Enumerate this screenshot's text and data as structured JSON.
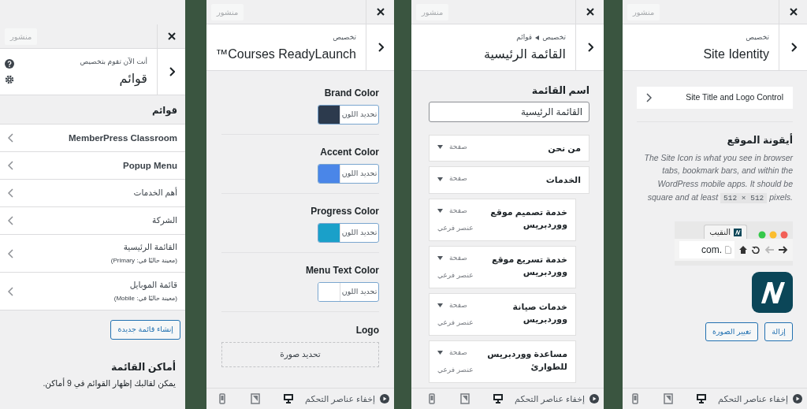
{
  "menus_panel": {
    "publish_button": {
      "label": "منشور",
      "disabled": true
    },
    "subtitle": "أنت الآن تقوم بتخصيص",
    "title": "قوائم",
    "section_title": "قوائم",
    "menus": [
      {
        "label": "MemberPress Classroom",
        "bold": true
      },
      {
        "label": "Popup Menu",
        "bold": true
      },
      {
        "label": "أهم الخدمات",
        "bold": false
      },
      {
        "label": "الشركة",
        "bold": false
      },
      {
        "label": "القائمة الرئيسية",
        "bold": false,
        "location": "(معينة حاليًا في: Primary)"
      },
      {
        "label": "قائمة الموبايل",
        "bold": false,
        "location": "(معينة حاليًا في: Mobile)"
      }
    ],
    "create_button": "إنشاء قائمة جديدة",
    "locations_title": "أماكن القائمة",
    "locations_text": "يمكن لقالبك إظهار القوائم في 9 أماكن."
  },
  "courses_panel": {
    "publish_button": {
      "label": "منشور",
      "disabled": true
    },
    "subtitle": "تخصيص",
    "title": "Courses ReadyLaunch™",
    "colors": [
      {
        "label": "Brand Color",
        "button_text": "تحديد اللون",
        "color": "#2c3a4d"
      },
      {
        "label": "Accent Color",
        "button_text": "تحديد اللون",
        "color": "#4a86e8"
      },
      {
        "label": "Progress Color",
        "button_text": "تحديد اللون",
        "color": "#1aa0c9"
      },
      {
        "label": "Menu Text Color",
        "button_text": "تحديد اللون",
        "color": "#ffffff"
      }
    ],
    "logo": {
      "label": "Logo",
      "button": "تحديد صورة"
    },
    "footer": {
      "hide_controls": "إخفاء عناصر التحكم",
      "devices": [
        {
          "kind": "desktop",
          "selected": true
        },
        {
          "kind": "tablet",
          "selected": false
        },
        {
          "kind": "mobile",
          "selected": false
        }
      ]
    }
  },
  "menu_edit_panel": {
    "publish_button": {
      "label": "منشور",
      "disabled": true
    },
    "breadcrumb": [
      "تخصيص",
      "قوائم"
    ],
    "title": "القائمة الرئيسية",
    "name_label": "اسم القائمة",
    "name_value": "القائمة الرئيسية",
    "items": [
      {
        "title": "من نحن",
        "type": "صفحة"
      },
      {
        "title": "الخدمات",
        "type": "صفحة",
        "children": [
          {
            "title": "خدمة تصميم موقع ووردبريس",
            "type": "صفحة",
            "sub_label": "عنصر فرعي"
          },
          {
            "title": "خدمة تسريع موقع ووردبريس",
            "type": "صفحة",
            "sub_label": "عنصر فرعي"
          },
          {
            "title": "خدمات صيانة ووردبريس",
            "type": "صفحة",
            "sub_label": "عنصر فرعي"
          },
          {
            "title": "مساعدة ووردبريس للطوارئ",
            "type": "صفحة",
            "sub_label": "عنصر فرعي"
          }
        ]
      }
    ],
    "footer": {
      "hide_controls": "إخفاء عناصر التحكم",
      "devices": [
        {
          "kind": "desktop",
          "selected": true
        },
        {
          "kind": "tablet",
          "selected": false
        },
        {
          "kind": "mobile",
          "selected": false
        }
      ]
    }
  },
  "site_identity_panel": {
    "publish_button": {
      "label": "منشور",
      "disabled": true
    },
    "subtitle": "تخصيص",
    "title": "Site Identity",
    "section_link": "Site Title and Logo Control",
    "icon_title": "أيقونة الموقع",
    "description": {
      "before": "The Site Icon is what you see in browser tabs, bookmark bars, and within the WordPress mobile apps. It should be square and at least ",
      "code": "512 × 512",
      "after": " pixels."
    },
    "preview": {
      "tab_title": "النقيب",
      "url": ".com"
    },
    "buttons": [
      "إزالة",
      "تغيير الصورة"
    ],
    "footer": {
      "hide_controls": "إخفاء عناصر التحكم",
      "devices": [
        {
          "kind": "desktop",
          "selected": true
        },
        {
          "kind": "tablet",
          "selected": false
        },
        {
          "kind": "mobile",
          "selected": false
        }
      ]
    }
  }
}
